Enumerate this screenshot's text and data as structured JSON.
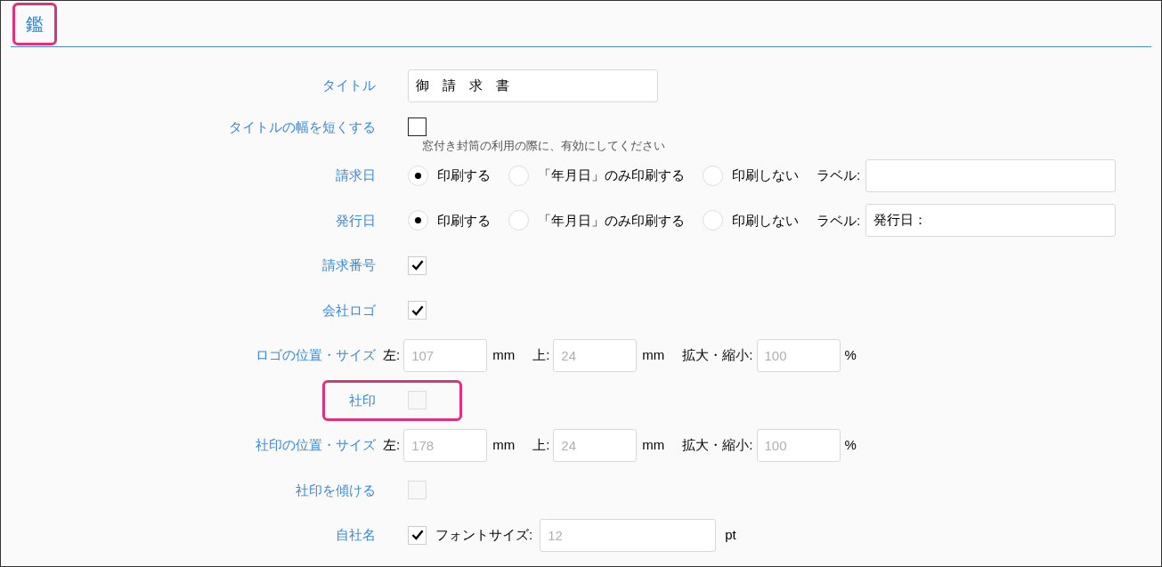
{
  "section": {
    "title": "鑑",
    "highlighted": true
  },
  "rows": [
    {
      "kind": "text",
      "label": "タイトル",
      "value": "御　請　求　書",
      "highlighted": false
    },
    {
      "kind": "checkbox",
      "label": "タイトルの幅を短くする",
      "checked": false,
      "disabled": false,
      "note": "窓付き封筒の利用の際に、有効にしてください",
      "highlighted": false
    },
    {
      "kind": "radio",
      "label": "請求日",
      "options": [
        {
          "label": "印刷する",
          "selected": true
        },
        {
          "label": "「年月日」のみ印刷する",
          "selected": false
        },
        {
          "label": "印刷しない",
          "selected": false
        }
      ],
      "field_label": "ラベル:",
      "highlighted": false
    },
    {
      "kind": "radio",
      "label": "発行日",
      "options": [
        {
          "label": "印刷する",
          "selected": true
        },
        {
          "label": "「年月日」のみ印刷する",
          "selected": false
        },
        {
          "label": "印刷しない",
          "selected": false
        }
      ],
      "field_label": "ラベル:",
      "value": "発行日：",
      "highlighted": false
    },
    {
      "kind": "checkbox",
      "label": "請求番号",
      "checked": true,
      "disabled": false,
      "highlighted": false
    },
    {
      "kind": "checkbox",
      "label": "会社ロゴ",
      "checked": true,
      "disabled": false,
      "highlighted": false
    },
    {
      "kind": "position",
      "label": "ロゴの位置・サイズ",
      "fields": [
        {
          "label": "左:",
          "placeholder": "107",
          "unit": "mm"
        },
        {
          "label": "上:",
          "placeholder": "24",
          "unit": "mm"
        },
        {
          "label": "拡大・縮小:",
          "placeholder": "100",
          "unit": "%"
        }
      ],
      "highlighted": false
    },
    {
      "kind": "checkbox",
      "label": "社印",
      "checked": false,
      "disabled": true,
      "highlighted": true
    },
    {
      "kind": "position",
      "label": "社印の位置・サイズ",
      "fields": [
        {
          "label": "左:",
          "placeholder": "178",
          "unit": "mm"
        },
        {
          "label": "上:",
          "placeholder": "24",
          "unit": "mm"
        },
        {
          "label": "拡大・縮小:",
          "placeholder": "100",
          "unit": "%"
        }
      ],
      "highlighted": false
    },
    {
      "kind": "checkbox",
      "label": "社印を傾ける",
      "checked": false,
      "disabled": true,
      "highlighted": false
    },
    {
      "kind": "checkbox",
      "label": "自社名",
      "checked": true,
      "disabled": false,
      "field": {
        "label": "フォントサイズ:",
        "placeholder": "12",
        "unit": "pt"
      },
      "highlighted": false
    }
  ]
}
